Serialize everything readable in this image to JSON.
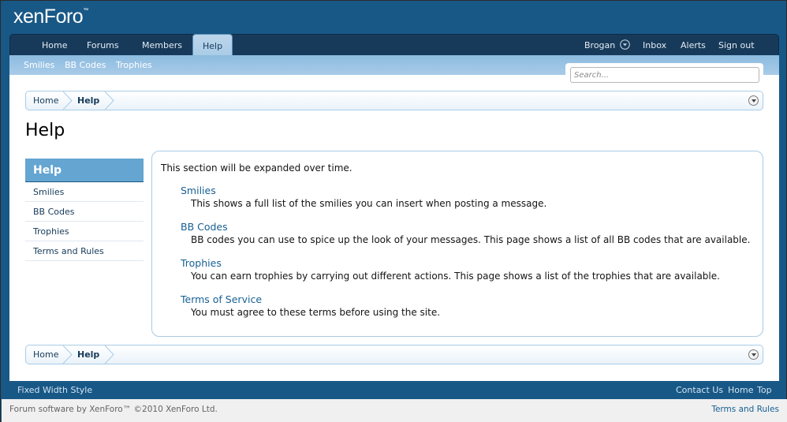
{
  "header": {
    "logo": "xenForo",
    "logo_mark": "™"
  },
  "nav": {
    "tabs": [
      "Home",
      "Forums",
      "Members",
      "Help"
    ],
    "selected": "Help",
    "user": "Brogan",
    "right_links": [
      "Inbox",
      "Alerts",
      "Sign out"
    ]
  },
  "subnav": {
    "items": [
      "Smilies",
      "BB Codes",
      "Trophies"
    ]
  },
  "search": {
    "placeholder": "Search..."
  },
  "breadcrumb": {
    "items": [
      "Home",
      "Help"
    ]
  },
  "page": {
    "title": "Help"
  },
  "sidebar": {
    "heading": "Help",
    "items": [
      "Smilies",
      "BB Codes",
      "Trophies",
      "Terms and Rules"
    ]
  },
  "main": {
    "intro": "This section will be expanded over time.",
    "topics": [
      {
        "title": "Smilies",
        "desc": "This shows a full list of the smilies you can insert when posting a message."
      },
      {
        "title": "BB Codes",
        "desc": "BB codes you can use to spice up the look of your messages. This page shows a list of all BB codes that are available."
      },
      {
        "title": "Trophies",
        "desc": "You can earn trophies by carrying out different actions. This page shows a list of the trophies that are available."
      },
      {
        "title": "Terms of Service",
        "desc": "You must agree to these terms before using the site."
      }
    ]
  },
  "footer": {
    "style": "Fixed Width Style",
    "links": [
      "Contact Us",
      "Home",
      "Top"
    ],
    "copyright": "Forum software by XenForo™ ©2010 XenForo Ltd.",
    "terms": "Terms and Rules"
  },
  "colors": {
    "header_bg": "#185886",
    "nav_bg": "#183a5a",
    "accent": "#65a5d1",
    "link": "#176093"
  }
}
